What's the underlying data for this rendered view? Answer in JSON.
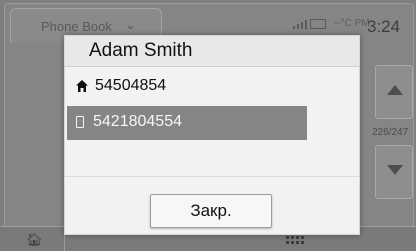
{
  "background_app": {
    "tab_label": "Phone Book",
    "status": {
      "temperature": "--°C",
      "time_period": "PM",
      "time": "3:24"
    },
    "list_position": "226/247"
  },
  "dialog": {
    "title": "Adam Smith",
    "numbers": [
      {
        "type_icon": "home-icon",
        "value": "54504854",
        "selected": false
      },
      {
        "type_icon": "mobile-phone-icon",
        "value": "5421804554",
        "selected": true
      }
    ],
    "close_label": "Закр."
  },
  "colors": {
    "selected_row": "#858585",
    "dialog_bg": "#f2f2f2",
    "dim_bg": "#7f7f7f"
  }
}
